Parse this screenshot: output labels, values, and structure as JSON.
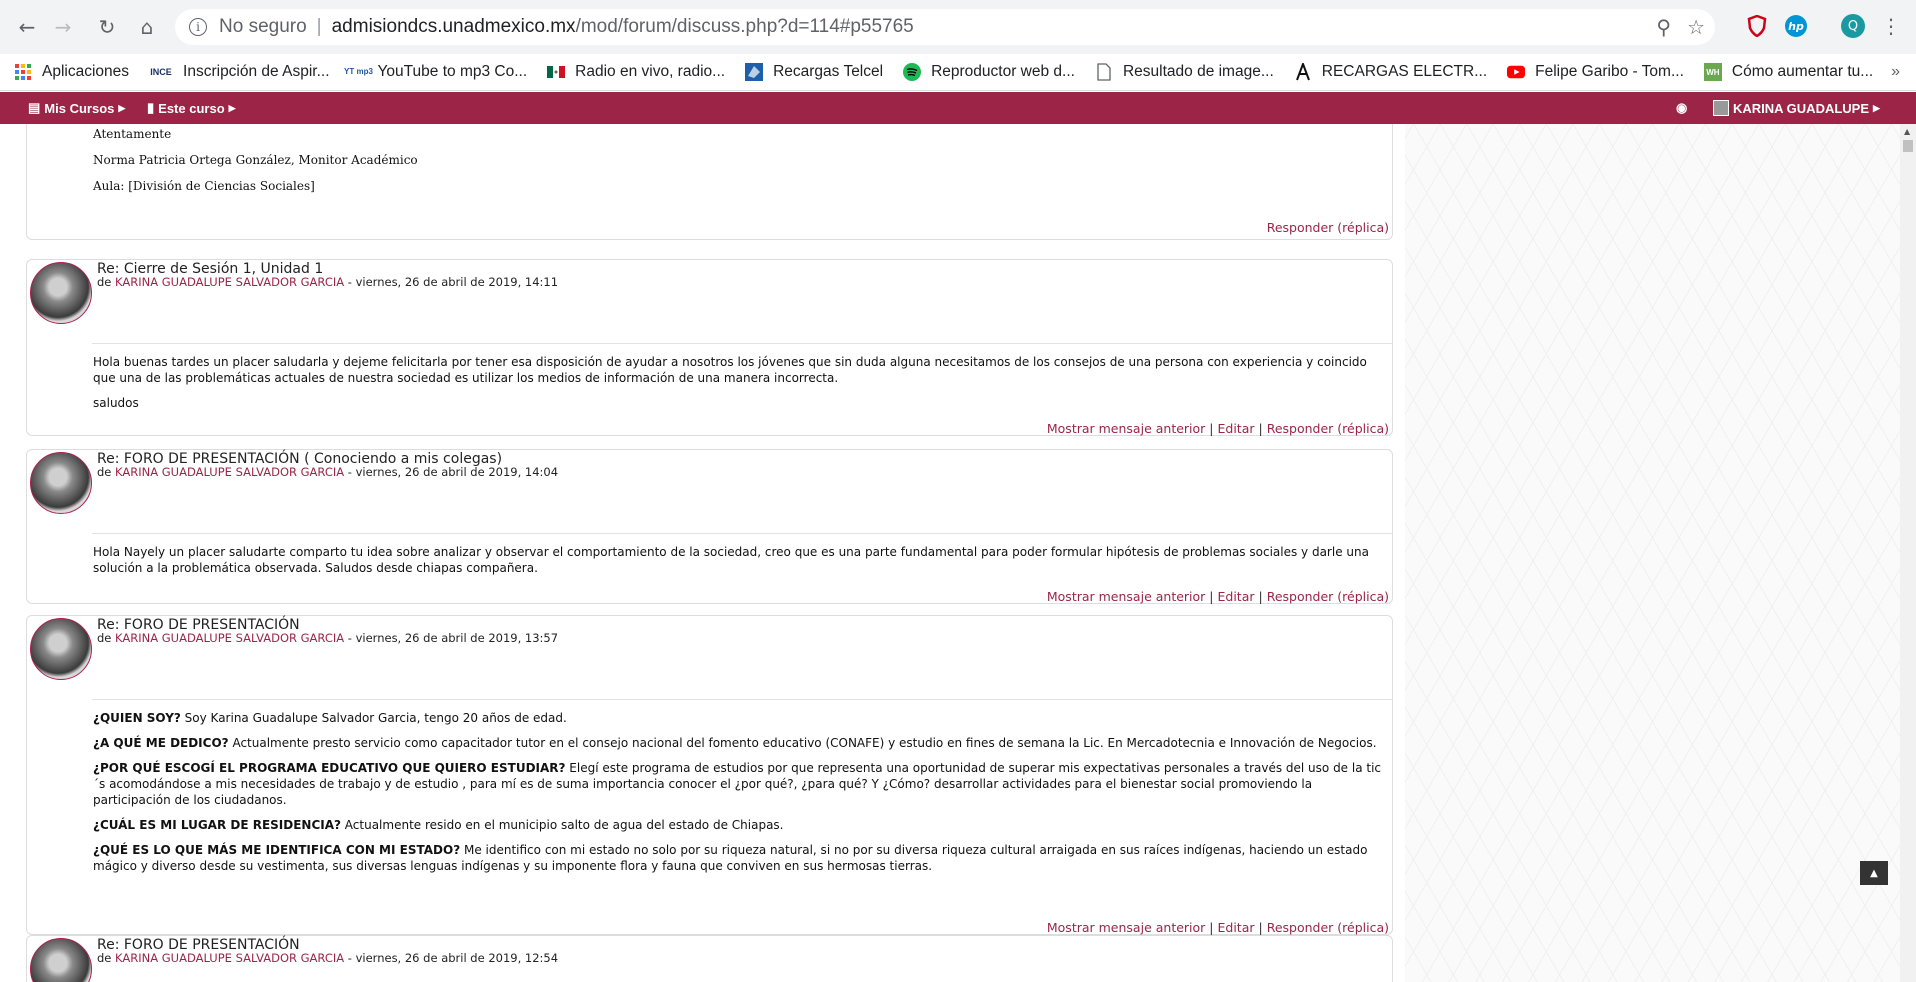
{
  "browser": {
    "secure_label": "No seguro",
    "url_host": "admisiondcs.unadmexico.mx",
    "url_path": "/mod/forum/discuss.php?d=114#p55765",
    "profile_initial": "Q"
  },
  "bookmarks": [
    {
      "label": "Aplicaciones",
      "icon": "apps-grid-icon"
    },
    {
      "label": "Inscripción de Aspir...",
      "icon": "ince-icon",
      "badge": "INCE"
    },
    {
      "label": "YouTube to mp3 Co...",
      "icon": "ytmp3-icon",
      "badge": "YT mp3"
    },
    {
      "label": "Radio en vivo, radio...",
      "icon": "mexico-flag-icon"
    },
    {
      "label": "Recargas Telcel",
      "icon": "telcel-icon"
    },
    {
      "label": "Reproductor web d...",
      "icon": "spotify-icon"
    },
    {
      "label": "Resultado de image...",
      "icon": "document-icon"
    },
    {
      "label": "RECARGAS ELECTR...",
      "icon": "recargas-icon"
    },
    {
      "label": "Felipe Garibo - Tom...",
      "icon": "youtube-icon"
    },
    {
      "label": "Cómo aumentar tu...",
      "icon": "wh-icon",
      "badge": "WH"
    }
  ],
  "sitebar": {
    "mis_cursos": "Mis Cursos",
    "este_curso": "Este curso",
    "user_name": "KARINA GUADALUPE"
  },
  "top_post": {
    "closing": "Atentamente",
    "signature": "Norma Patricia Ortega González, Monitor Académico",
    "aula": "Aula: [División de Ciencias Sociales]",
    "reply": "Responder (réplica)"
  },
  "links": {
    "show_prev": "Mostrar mensaje anterior",
    "edit": "Editar",
    "reply": "Responder (réplica)",
    "sep": "|"
  },
  "posts": [
    {
      "subject": "Re: Cierre de Sesión 1, Unidad 1",
      "by": "de",
      "author": "KARINA GUADALUPE SALVADOR GARCIA",
      "date": " - viernes, 26 de abril de 2019, 14:11",
      "p1": "Hola  buenas tardes un placer saludarla y dejeme felicitarla por tener esa disposición de ayudar a nosotros los jóvenes que sin duda alguna necesitamos de los consejos de una persona con experiencia y coincido que una de las problemáticas actuales de nuestra sociedad es utilizar los medios de información de una manera incorrecta.",
      "p2": "saludos"
    },
    {
      "subject": "Re: FORO DE PRESENTACIÓN ( Conociendo a mis colegas)",
      "by": "de",
      "author": "KARINA GUADALUPE SALVADOR GARCIA",
      "date": " - viernes, 26 de abril de 2019, 14:04",
      "p1": "Hola Nayely un placer saludarte comparto tu idea sobre analizar y observar el comportamiento de la sociedad, creo que es una parte fundamental para poder formular hipótesis de problemas sociales y darle una solución a la problemática observada. Saludos desde chiapas compañera."
    },
    {
      "subject": "Re: FORO DE PRESENTACIÓN",
      "by": "de",
      "author": "KARINA GUADALUPE SALVADOR GARCIA",
      "date": " - viernes, 26 de abril de 2019, 13:57",
      "q1": "¿QUIEN SOY?",
      "a1": " Soy Karina Guadalupe Salvador Garcia, tengo 20 años de edad.",
      "q2": "¿A QUÉ ME DEDICO?",
      "a2": " Actualmente presto servicio como capacitador tutor en el consejo nacional del fomento educativo (CONAFE) y estudio en fines de semana la Lic.  En Mercadotecnia e Innovación de Negocios.",
      "q3": " ¿POR QUÉ ESCOGÍ EL PROGRAMA EDUCATIVO QUE QUIERO ESTUDIAR?",
      "a3": " Elegí este programa de estudios por que representa una oportunidad de superar mis expectativas personales a través del uso de la tic´s acomodándose a mis necesidades de trabajo  y de estudio , para mí es de suma importancia conocer el ¿por qué?, ¿para qué? Y ¿Cómo? desarrollar actividades para  el bienestar social promoviendo la participación de los ciudadanos.",
      "q4": " ¿CUÁL ES MI LUGAR DE RESIDENCIA?",
      "a4": " Actualmente resido en el municipio salto de agua del estado de Chiapas.",
      "q5": "¿QUÉ ES LO QUE MÁS ME IDENTIFICA CON MI ESTADO?",
      "a5": " Me identifico con mi estado no solo por su riqueza natural, si no por su diversa riqueza cultural arraigada en sus raíces indígenas, haciendo un estado mágico y diverso  desde su vestimenta, sus diversas lenguas indígenas y su imponente flora y fauna que conviven en sus hermosas tierras."
    },
    {
      "subject": "Re: FORO DE PRESENTACIÓN",
      "by": "de",
      "author": "KARINA GUADALUPE SALVADOR GARCIA",
      "date": " - viernes, 26 de abril de 2019, 12:54"
    }
  ]
}
